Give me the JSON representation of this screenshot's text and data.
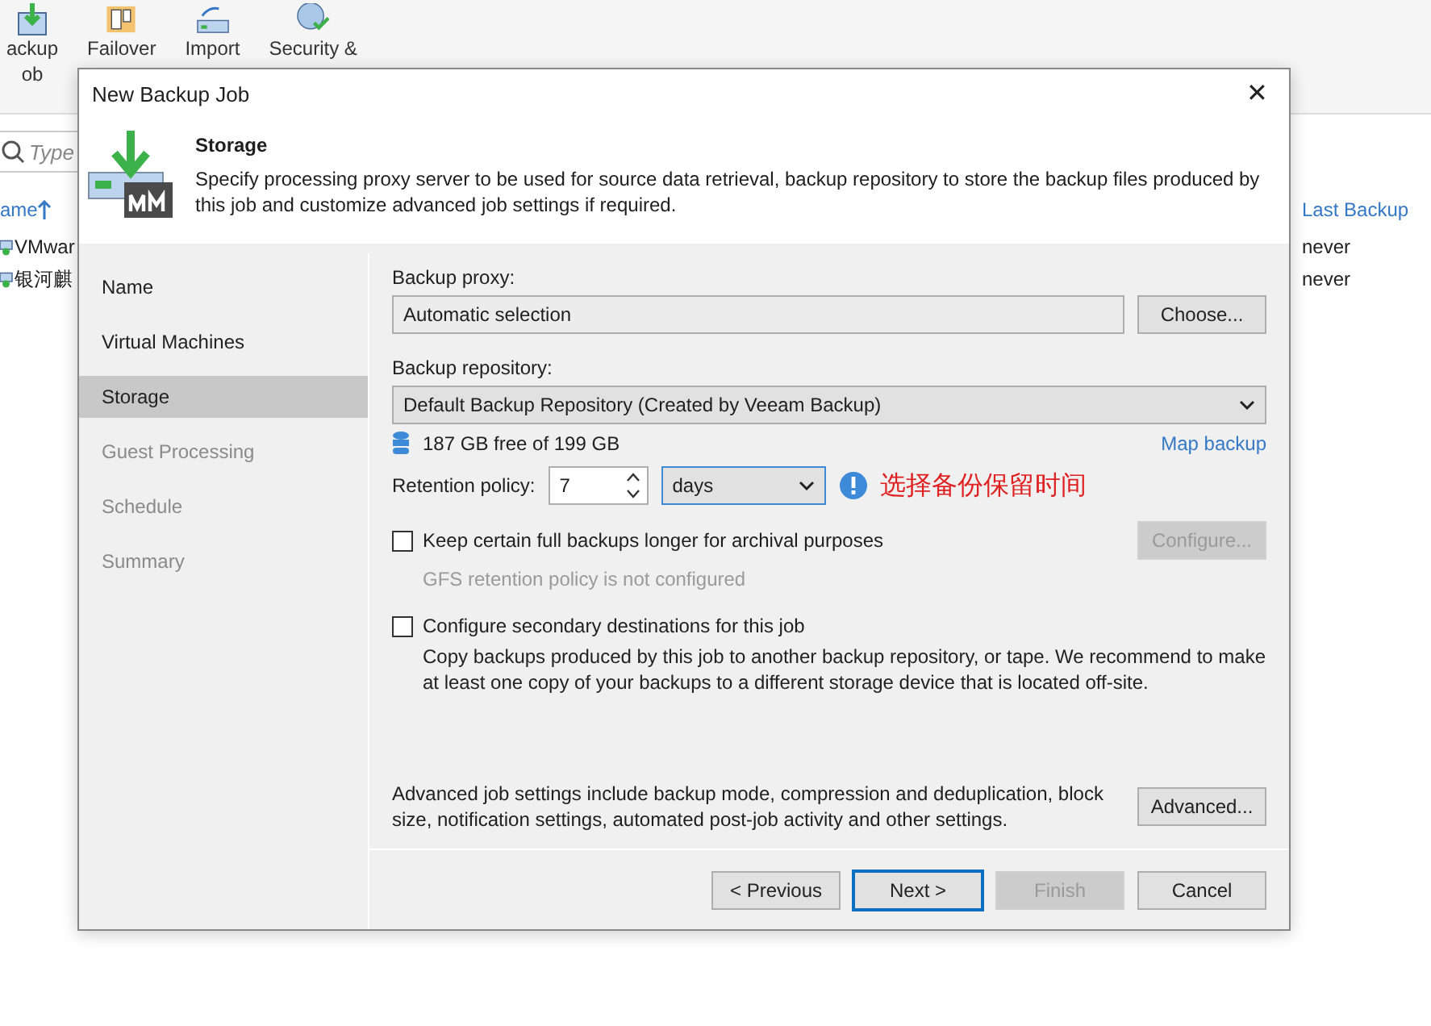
{
  "ribbon": [
    {
      "lines": [
        "ackup",
        "ob"
      ],
      "kind": "job"
    },
    {
      "lines": [
        "Failover"
      ],
      "kind": "failover"
    },
    {
      "lines": [
        "Import"
      ],
      "kind": "import"
    },
    {
      "lines": [
        "Security &"
      ],
      "kind": "security"
    }
  ],
  "search": {
    "placeholder": "Type"
  },
  "table": {
    "columns": [
      {
        "label": "ame",
        "sorted": true
      },
      {
        "label": "Last Backup",
        "sorted": false
      }
    ],
    "rows": [
      [
        "VMwar",
        "never"
      ],
      [
        "银河麒",
        "never"
      ]
    ]
  },
  "dialog": {
    "title": "New Backup Job",
    "close": "✕",
    "header": {
      "title": "Storage",
      "description": "Specify processing proxy server to be used for source data retrieval, backup repository to store the backup files produced by this job and customize advanced job settings if required."
    },
    "steps": [
      {
        "label": "Name",
        "selected": false,
        "disabled": false
      },
      {
        "label": "Virtual Machines",
        "selected": false,
        "disabled": false
      },
      {
        "label": "Storage",
        "selected": true,
        "disabled": false
      },
      {
        "label": "Guest Processing",
        "selected": false,
        "disabled": true
      },
      {
        "label": "Schedule",
        "selected": false,
        "disabled": true
      },
      {
        "label": "Summary",
        "selected": false,
        "disabled": true
      }
    ],
    "proxy": {
      "label": "Backup proxy:",
      "value": "Automatic selection",
      "button": "Choose..."
    },
    "repository": {
      "label": "Backup repository:",
      "value": "Default Backup Repository (Created by Veeam Backup)",
      "free": "187 GB free of 199 GB",
      "link": "Map backup"
    },
    "retention": {
      "label": "Retention policy:",
      "value": "7",
      "unit": "days",
      "note": "选择备份保留时间"
    },
    "options": [
      {
        "label": "Keep certain full backups longer for archival purposes",
        "checked": false,
        "description": "GFS retention policy is not configured",
        "muted": true,
        "button": "Configure...",
        "button_disabled": true
      },
      {
        "label": "Configure secondary destinations for this job",
        "checked": false,
        "description": "Copy backups produced by this job to another backup repository, or tape. We recommend to make at least one copy of your backups to a different storage device that is located off-site.",
        "muted": false
      }
    ],
    "advanced": {
      "text": "Advanced job settings include backup mode, compression and deduplication, block size, notification settings, automated post-job activity and other settings.",
      "button": "Advanced..."
    },
    "buttons": [
      {
        "label": "< Previous",
        "disabled": false,
        "default": false
      },
      {
        "label": "Next >",
        "disabled": false,
        "default": true
      },
      {
        "label": "Finish",
        "disabled": true,
        "default": false
      },
      {
        "label": "Cancel",
        "disabled": false,
        "default": false
      }
    ]
  }
}
